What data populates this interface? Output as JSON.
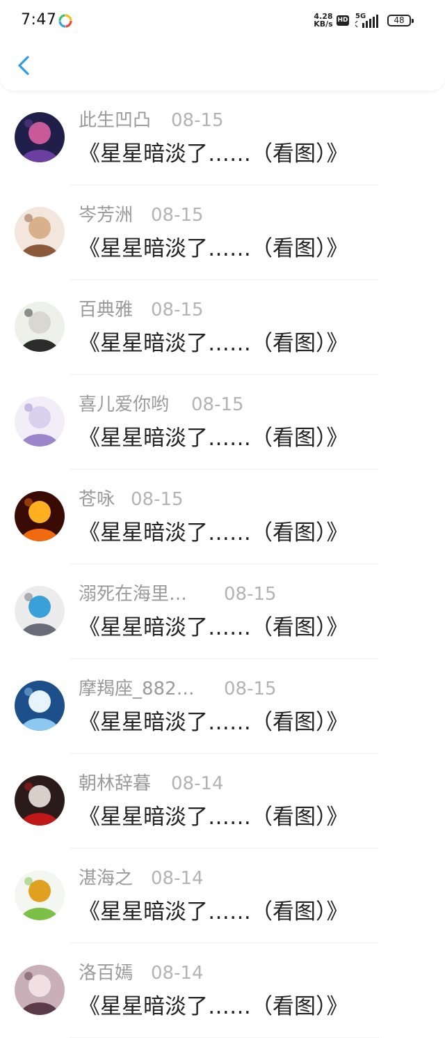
{
  "status_bar": {
    "time": "7:47",
    "net_speed_value": "4.28",
    "net_speed_unit": "KB/s",
    "hd_label": "HD",
    "network_label": "5G",
    "battery": "48"
  },
  "nav": {
    "back_icon": "chevron-left-icon",
    "accent": "#2f9ae8"
  },
  "items": [
    {
      "name": "此生凹凸",
      "date": "08-15",
      "title": "《星星暗淡了……（看图）》",
      "avatar_colors": [
        "#1f1f4a",
        "#6b3fa0",
        "#c85a9a"
      ]
    },
    {
      "name": "岑芳洲",
      "date": "08-15",
      "title": "《星星暗淡了……（看图）》",
      "avatar_colors": [
        "#f3e6dc",
        "#8a5a3a",
        "#d9b08c"
      ]
    },
    {
      "name": "百典雅",
      "date": "08-15",
      "title": "《星星暗淡了……（看图）》",
      "avatar_colors": [
        "#eef0ea",
        "#2b2b2b",
        "#d8d8d0"
      ]
    },
    {
      "name": "喜儿爱你哟",
      "date": "08-15",
      "title": "《星星暗淡了……（看图）》",
      "avatar_colors": [
        "#f2eef8",
        "#9a86c8",
        "#d9d0ee"
      ]
    },
    {
      "name": "苍咏",
      "date": "08-15",
      "title": "《星星暗淡了……（看图）》",
      "avatar_colors": [
        "#3a0a05",
        "#f06a10",
        "#ffb020"
      ]
    },
    {
      "name": "溺死在海里…",
      "date": "08-15",
      "title": "《星星暗淡了……（看图）》",
      "avatar_colors": [
        "#ececec",
        "#6a6a78",
        "#3aa0d8"
      ]
    },
    {
      "name": "摩羯座_882…",
      "date": "08-15",
      "title": "《星星暗淡了……（看图）》",
      "avatar_colors": [
        "#1d4f8a",
        "#8cc8f0",
        "#e8f4fc"
      ]
    },
    {
      "name": "朝林辞暮",
      "date": "08-14",
      "title": "《星星暗淡了……（看图）》",
      "avatar_colors": [
        "#2a1a1a",
        "#c01818",
        "#d8d0c8"
      ]
    },
    {
      "name": "湛海之",
      "date": "08-14",
      "title": "《星星暗淡了……（看图）》",
      "avatar_colors": [
        "#f4f6f2",
        "#7cc048",
        "#e0a020"
      ]
    },
    {
      "name": "洛百嫣",
      "date": "08-14",
      "title": "《星星暗淡了……（看图）》",
      "avatar_colors": [
        "#c9b0b8",
        "#5a3a48",
        "#f0e0e4"
      ]
    }
  ]
}
